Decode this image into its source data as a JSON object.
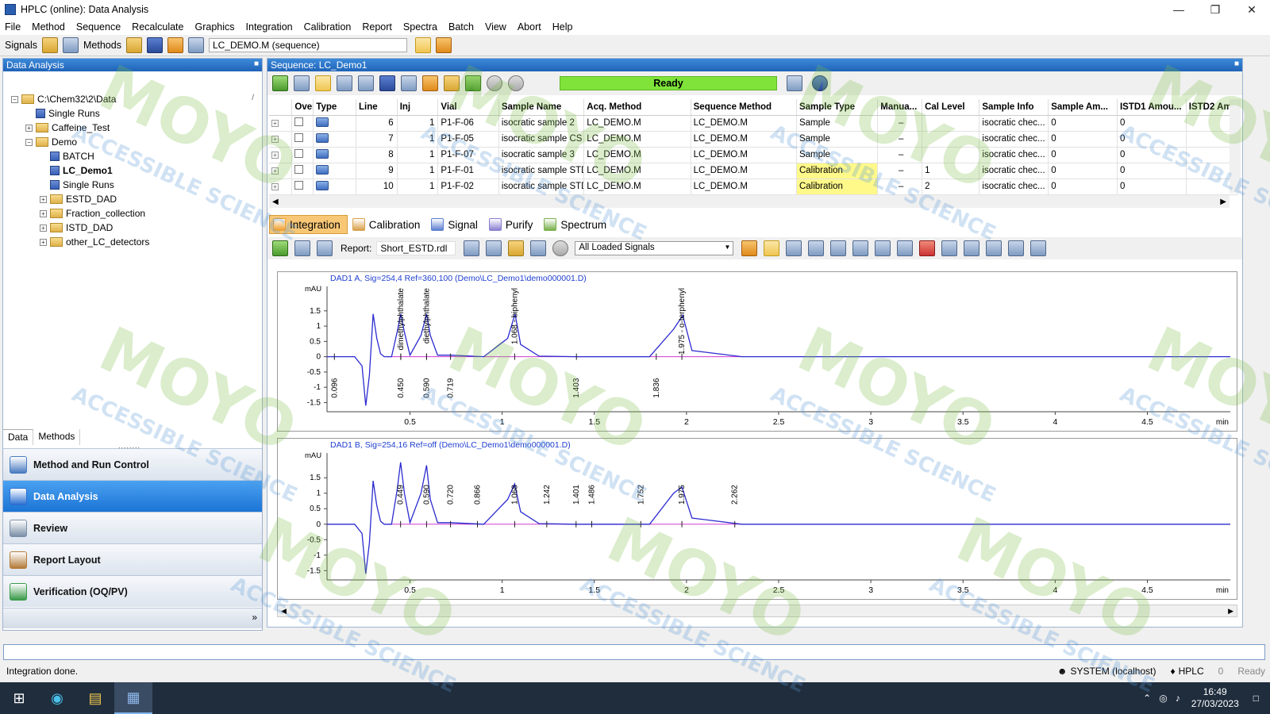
{
  "window": {
    "title": "HPLC (online): Data Analysis"
  },
  "menu": [
    "File",
    "Method",
    "Sequence",
    "Recalculate",
    "Graphics",
    "Integration",
    "Calibration",
    "Report",
    "Spectra",
    "Batch",
    "View",
    "Abort",
    "Help"
  ],
  "toolbar": {
    "signals_label": "Signals",
    "methods_label": "Methods",
    "method_sequence": "LC_DEMO.M (sequence)"
  },
  "left": {
    "title": "Data Analysis",
    "tree": [
      {
        "label": "C:\\Chem32\\2\\Data",
        "level": 0,
        "toggle": "−",
        "icon": "folder"
      },
      {
        "label": "Single Runs",
        "level": 1,
        "toggle": "",
        "icon": "file"
      },
      {
        "label": "Caffeine_Test",
        "level": 1,
        "toggle": "+",
        "icon": "folder"
      },
      {
        "label": "Demo",
        "level": 1,
        "toggle": "−",
        "icon": "folder"
      },
      {
        "label": "BATCH",
        "level": 2,
        "toggle": "",
        "icon": "file"
      },
      {
        "label": "LC_Demo1",
        "level": 2,
        "toggle": "",
        "icon": "file",
        "bold": true
      },
      {
        "label": "Single Runs",
        "level": 2,
        "toggle": "",
        "icon": "file"
      },
      {
        "label": "ESTD_DAD",
        "level": 2,
        "toggle": "+",
        "icon": "folder"
      },
      {
        "label": "Fraction_collection",
        "level": 2,
        "toggle": "+",
        "icon": "folder"
      },
      {
        "label": "ISTD_DAD",
        "level": 2,
        "toggle": "+",
        "icon": "folder"
      },
      {
        "label": "other_LC_detectors",
        "level": 2,
        "toggle": "+",
        "icon": "folder"
      }
    ],
    "tabs": {
      "data": "Data",
      "methods": "Methods"
    },
    "nav": [
      {
        "label": "Method and Run Control",
        "active": false
      },
      {
        "label": "Data Analysis",
        "active": true
      },
      {
        "label": "Review",
        "active": false
      },
      {
        "label": "Report Layout",
        "active": false
      },
      {
        "label": "Verification (OQ/PV)",
        "active": false
      }
    ]
  },
  "sequence": {
    "title": "Sequence: LC_Demo1",
    "status": "Ready",
    "columns": [
      "Overlay",
      "Type",
      "Line",
      "Inj",
      "Vial",
      "Sample Name",
      "Acq. Method",
      "Sequence Method",
      "Sample Type",
      "Manua...",
      "Cal Level",
      "Sample Info",
      "Sample Am...",
      "ISTD1 Amou...",
      "ISTD2 Am"
    ],
    "rows": [
      {
        "line": "6",
        "inj": "1",
        "vial": "P1-F-06",
        "name": "isocratic sample 2",
        "acq": "LC_DEMO.M",
        "seq": "LC_DEMO.M",
        "type": "Sample",
        "manual": "–",
        "cal": "",
        "info": "isocratic chec...",
        "amt": "0",
        "istd1": "0",
        "istd2": ""
      },
      {
        "line": "7",
        "inj": "1",
        "vial": "P1-F-05",
        "name": "isocratic sample CS",
        "acq": "LC_DEMO.M",
        "seq": "LC_DEMO.M",
        "type": "Sample",
        "manual": "–",
        "cal": "",
        "info": "isocratic chec...",
        "amt": "0",
        "istd1": "0",
        "istd2": ""
      },
      {
        "line": "8",
        "inj": "1",
        "vial": "P1-F-07",
        "name": "isocratic sample 3",
        "acq": "LC_DEMO.M",
        "seq": "LC_DEMO.M",
        "type": "Sample",
        "manual": "–",
        "cal": "",
        "info": "isocratic chec...",
        "amt": "0",
        "istd1": "0",
        "istd2": ""
      },
      {
        "line": "9",
        "inj": "1",
        "vial": "P1-F-01",
        "name": "isocratic sample STD",
        "acq": "LC_DEMO.M",
        "seq": "LC_DEMO.M",
        "type": "Calibration",
        "manual": "–",
        "cal": "1",
        "info": "isocratic chec...",
        "amt": "0",
        "istd1": "0",
        "istd2": ""
      },
      {
        "line": "10",
        "inj": "1",
        "vial": "P1-F-02",
        "name": "isocratic sample STD",
        "acq": "LC_DEMO.M",
        "seq": "LC_DEMO.M",
        "type": "Calibration",
        "manual": "–",
        "cal": "2",
        "info": "isocratic chec...",
        "amt": "0",
        "istd1": "0",
        "istd2": ""
      }
    ]
  },
  "tabs": [
    "Integration",
    "Calibration",
    "Signal",
    "Purify",
    "Spectrum"
  ],
  "integration_toolbar": {
    "report_label": "Report:",
    "report_file": "Short_ESTD.rdl",
    "signal_select": "All Loaded Signals"
  },
  "chart_data": [
    {
      "type": "line",
      "title": "DAD1 A, Sig=254,4 Ref=360,100 (Demo\\LC_Demo1\\demo000001.D)",
      "ylabel": "mAU",
      "xlabel": "min",
      "xlim": [
        0.05,
        4.95
      ],
      "ylim": [
        -1.8,
        2.3
      ],
      "xticks": [
        "0.5",
        "1",
        "1.5",
        "2",
        "2.5",
        "3",
        "3.5",
        "4",
        "4.5"
      ],
      "yticks": [
        "1.5",
        "1",
        "0.5",
        "0",
        "-0.5",
        "-1",
        "-1.5"
      ],
      "series": [
        {
          "x": [
            0.05,
            0.2,
            0.24,
            0.26,
            0.28,
            0.3,
            0.32,
            0.34,
            0.36,
            0.4,
            0.43,
            0.45,
            0.47,
            0.5,
            0.56,
            0.59,
            0.61,
            0.65,
            0.72,
            0.9,
            1.03,
            1.07,
            1.1,
            1.2,
            1.4,
            1.8,
            1.93,
            1.98,
            2.03,
            2.3,
            3,
            4,
            4.95
          ],
          "y": [
            0,
            0,
            -0.3,
            -1.6,
            -0.6,
            1.4,
            0.6,
            0.1,
            0,
            0,
            0.8,
            1.4,
            0.8,
            0.05,
            0.7,
            1.4,
            0.7,
            0.05,
            0.05,
            0,
            0.6,
            1.4,
            0.4,
            0.02,
            0,
            0,
            0.9,
            1.35,
            0.2,
            0,
            0,
            0,
            0
          ]
        }
      ],
      "peak_labels": [
        {
          "x": 0.45,
          "text": "dimethylphthalate"
        },
        {
          "x": 0.59,
          "text": "diethylphthalate"
        },
        {
          "x": 0.72,
          "text": "0.719"
        },
        {
          "x": 1.068,
          "text": "1.068 - biphenyl"
        },
        {
          "x": 1.403,
          "text": "1.403"
        },
        {
          "x": 1.836,
          "text": "1.836"
        },
        {
          "x": 1.975,
          "text": "1.975 - o-terphenyl"
        },
        {
          "x": 0.45,
          "text": "0.450"
        },
        {
          "x": 0.59,
          "text": "0.590"
        },
        {
          "x": 0.09,
          "text": "0.096"
        }
      ]
    },
    {
      "type": "line",
      "title": "DAD1 B, Sig=254,16 Ref=off (Demo\\LC_Demo1\\demo000001.D)",
      "ylabel": "mAU",
      "xlabel": "min",
      "xlim": [
        0.05,
        4.95
      ],
      "ylim": [
        -1.8,
        2.3
      ],
      "xticks": [
        "0.5",
        "1",
        "1.5",
        "2",
        "2.5",
        "3",
        "3.5",
        "4",
        "4.5"
      ],
      "yticks": [
        "1.5",
        "1",
        "0.5",
        "0",
        "-0.5",
        "-1",
        "-1.5"
      ],
      "series": [
        {
          "x": [
            0.05,
            0.2,
            0.24,
            0.26,
            0.28,
            0.3,
            0.32,
            0.34,
            0.36,
            0.4,
            0.43,
            0.449,
            0.47,
            0.5,
            0.56,
            0.59,
            0.61,
            0.65,
            0.72,
            0.9,
            1.03,
            1.068,
            1.1,
            1.2,
            1.4,
            1.8,
            1.93,
            1.975,
            2.03,
            2.3,
            3,
            4,
            4.95
          ],
          "y": [
            0,
            0,
            -0.3,
            -1.6,
            -0.6,
            1.4,
            0.6,
            0.1,
            0,
            0,
            1.1,
            2.0,
            1.0,
            0.05,
            1.0,
            1.9,
            0.8,
            0.05,
            0.05,
            0,
            0.8,
            1.3,
            0.4,
            0.02,
            0,
            0,
            1.0,
            1.2,
            0.2,
            0,
            0,
            0,
            0
          ]
        }
      ],
      "peak_labels": [
        {
          "x": 0.449,
          "text": "0.449"
        },
        {
          "x": 0.59,
          "text": "0.590"
        },
        {
          "x": 0.72,
          "text": "0.720"
        },
        {
          "x": 0.866,
          "text": "0.866"
        },
        {
          "x": 1.068,
          "text": "1.068"
        },
        {
          "x": 1.242,
          "text": "1.242"
        },
        {
          "x": 1.401,
          "text": "1.401"
        },
        {
          "x": 1.486,
          "text": "1.486"
        },
        {
          "x": 1.752,
          "text": "1.752"
        },
        {
          "x": 1.975,
          "text": "1.975"
        },
        {
          "x": 2.262,
          "text": "2.262"
        }
      ]
    }
  ],
  "status": {
    "message": "Integration done.",
    "user": "SYSTEM (localhost)",
    "instrument": "HPLC",
    "count": "0",
    "state": "Ready"
  },
  "taskbar": {
    "time": "16:49",
    "date": "27/03/2023"
  },
  "watermark": {
    "text1": "MOYO",
    "text2": "ACCESSIBLE SCIENCE",
    "color": "#7fc04a"
  }
}
